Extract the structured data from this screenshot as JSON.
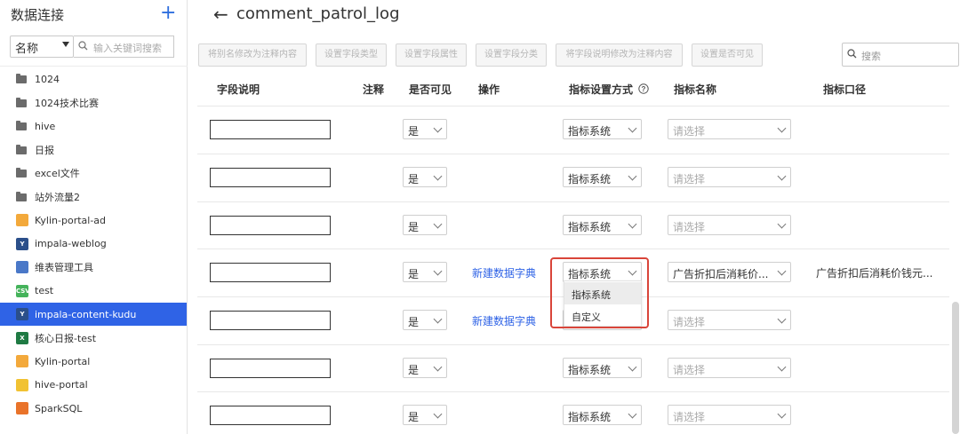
{
  "sidebar": {
    "title": "数据连接",
    "add_label": "+",
    "filter_select": "名称",
    "search_placeholder": "输入关键词搜索",
    "items": [
      {
        "label": "1024",
        "icon": "folder-icon"
      },
      {
        "label": "1024技术比赛",
        "icon": "folder-icon"
      },
      {
        "label": "hive",
        "icon": "folder-icon"
      },
      {
        "label": "日报",
        "icon": "folder-icon"
      },
      {
        "label": "excel文件",
        "icon": "folder-icon"
      },
      {
        "label": "站外流量2",
        "icon": "folder-icon"
      },
      {
        "label": "Kylin-portal-ad",
        "icon": "kylin-icon"
      },
      {
        "label": "impala-weblog",
        "icon": "impala-icon"
      },
      {
        "label": "维表管理工具",
        "icon": "chart-icon"
      },
      {
        "label": "test",
        "icon": "csv-icon"
      },
      {
        "label": "impala-content-kudu",
        "icon": "impala-icon"
      },
      {
        "label": "核心日报-test",
        "icon": "excel-icon"
      },
      {
        "label": "Kylin-portal",
        "icon": "kylin-icon"
      },
      {
        "label": "hive-portal",
        "icon": "hive-icon"
      },
      {
        "label": "SparkSQL",
        "icon": "spark-icon"
      }
    ],
    "selected_index": 10
  },
  "header": {
    "back_icon": "←",
    "title": "comment_patrol_log"
  },
  "toolbar": {
    "buttons": [
      "将别名修改为注释内容",
      "设置字段类型",
      "设置字段属性",
      "设置字段分类",
      "将字段说明修改为注释内容",
      "设置是否可见"
    ],
    "search_placeholder": "搜索"
  },
  "table": {
    "headers": {
      "description": "字段说明",
      "comment": "注释",
      "visible": "是否可见",
      "action": "操作",
      "metric_method": "指标设置方式",
      "metric_name": "指标名称",
      "metric_caliber": "指标口径"
    },
    "rows": [
      {
        "visible": "是",
        "action": "",
        "method": "指标系统",
        "metric_name": "请选择",
        "caliber": ""
      },
      {
        "visible": "是",
        "action": "",
        "method": "指标系统",
        "metric_name": "请选择",
        "caliber": ""
      },
      {
        "visible": "是",
        "action": "",
        "method": "指标系统",
        "metric_name": "请选择",
        "caliber": ""
      },
      {
        "visible": "是",
        "action": "新建数据字典",
        "method": "指标系统",
        "metric_name": "广告折扣后消耗价...",
        "caliber": "广告折扣后消耗价钱元..."
      },
      {
        "visible": "是",
        "action": "新建数据字典",
        "method": "指标系统",
        "metric_name": "请选择",
        "caliber": ""
      },
      {
        "visible": "是",
        "action": "",
        "method": "指标系统",
        "metric_name": "请选择",
        "caliber": ""
      },
      {
        "visible": "是",
        "action": "",
        "method": "指标系统",
        "metric_name": "请选择",
        "caliber": ""
      }
    ]
  },
  "dropdown": {
    "options": [
      "指标系统",
      "自定义"
    ],
    "active_index": 0
  },
  "colors": {
    "accent": "#2f63e6",
    "highlight": "#d9453a"
  }
}
